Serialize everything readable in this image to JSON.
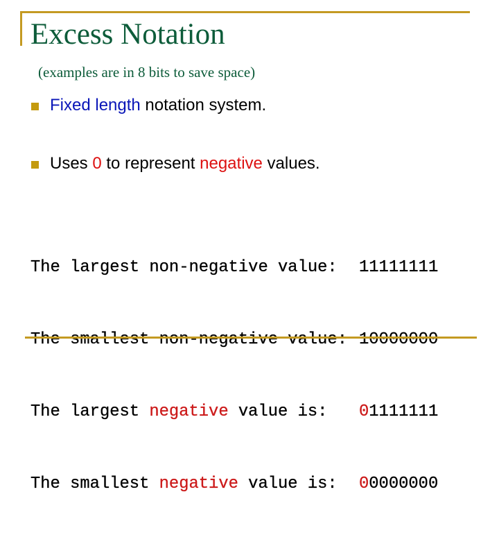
{
  "slide": {
    "title": "Excess Notation",
    "subtitle": "(examples are in 8 bits to save space)",
    "colors": {
      "title": "#0d5c3a",
      "rule": "#c49a22",
      "bullet_marker": "#c49a0e",
      "highlight_blue": "#0a16b8",
      "highlight_red": "#dd1111"
    },
    "bullets": [
      {
        "marker_icon": "square-bullet-icon",
        "parts": [
          {
            "text": "Fixed length",
            "style": "blue"
          },
          {
            "text": " notation system.",
            "style": "normal"
          }
        ]
      },
      {
        "marker_icon": "square-bullet-icon",
        "parts": [
          {
            "text": "Uses ",
            "style": "normal"
          },
          {
            "text": "0",
            "style": "red"
          },
          {
            "text": " to represent ",
            "style": "normal"
          },
          {
            "text": "negative",
            "style": "red"
          },
          {
            "text": " values.",
            "style": "normal"
          }
        ]
      }
    ],
    "examples": [
      {
        "label_pre": "The largest ",
        "label_highlight": "",
        "label_post": "non-negative value:",
        "value_highlight": "",
        "value_rest": "11111111"
      },
      {
        "label_pre": "The smallest ",
        "label_highlight": "",
        "label_post": "non-negative value:",
        "value_highlight": "",
        "value_rest": "10000000"
      },
      {
        "label_pre": "The largest ",
        "label_highlight": "negative",
        "label_post": " value is:",
        "value_highlight": "0",
        "value_rest": "1111111"
      },
      {
        "label_pre": "The smallest ",
        "label_highlight": "negative",
        "label_post": " value is:",
        "value_highlight": "0",
        "value_rest": "0000000"
      }
    ]
  }
}
